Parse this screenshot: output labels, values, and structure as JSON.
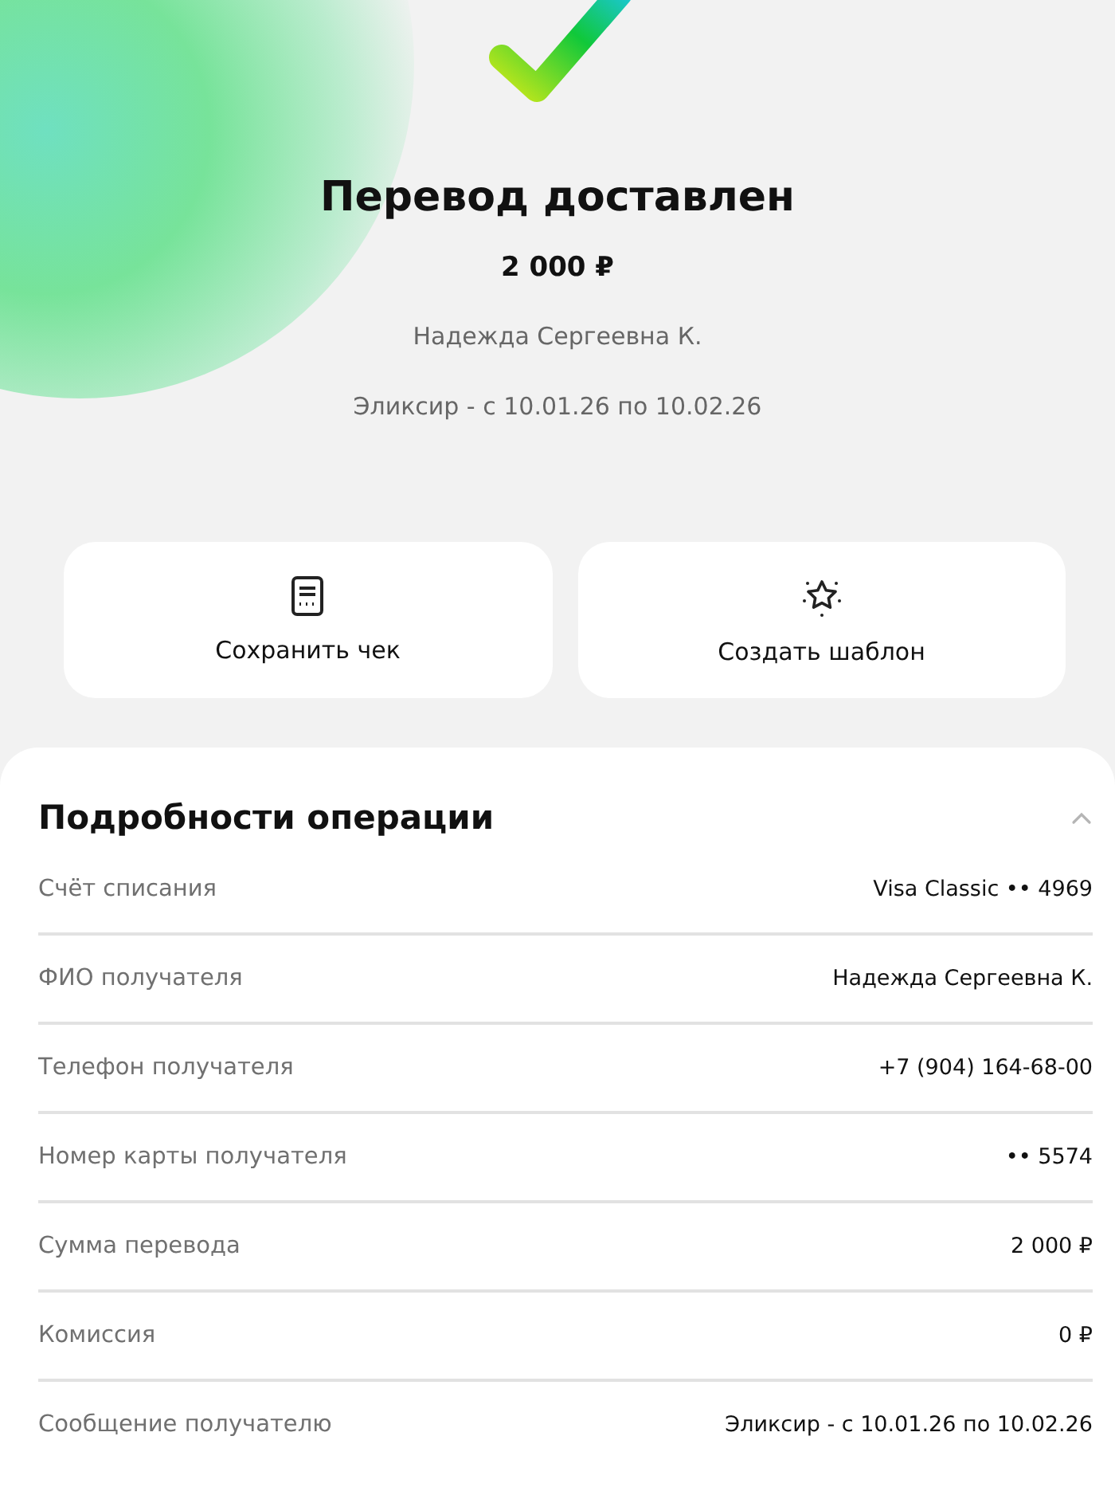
{
  "status": {
    "title": "Перевод доставлен",
    "amount": "2 000 ₽",
    "recipient": "Надежда Сергеевна К.",
    "message": "Эликсир - с 10.01.26 по 10.02.26"
  },
  "actions": [
    {
      "kind": "receipt",
      "label": "Сохранить чек"
    },
    {
      "kind": "template",
      "label": "Создать шаблон"
    }
  ],
  "details": {
    "title": "Подробности операции",
    "expanded": true,
    "rows": [
      {
        "label": "Счёт списания",
        "value": "Visa Classic •• 4969"
      },
      {
        "label": "ФИО получателя",
        "value": "Надежда Сергеевна К."
      },
      {
        "label": "Телефон получателя",
        "value": "+7 (904) 164-68-00"
      },
      {
        "label": "Номер карты получателя",
        "value": "•• 5574"
      },
      {
        "label": "Сумма перевода",
        "value": "2 000 ₽"
      },
      {
        "label": "Комиссия",
        "value": "0 ₽"
      },
      {
        "label": "Сообщение получателю",
        "value": "Эликсир - с 10.01.26 по 10.02.26"
      }
    ]
  }
}
